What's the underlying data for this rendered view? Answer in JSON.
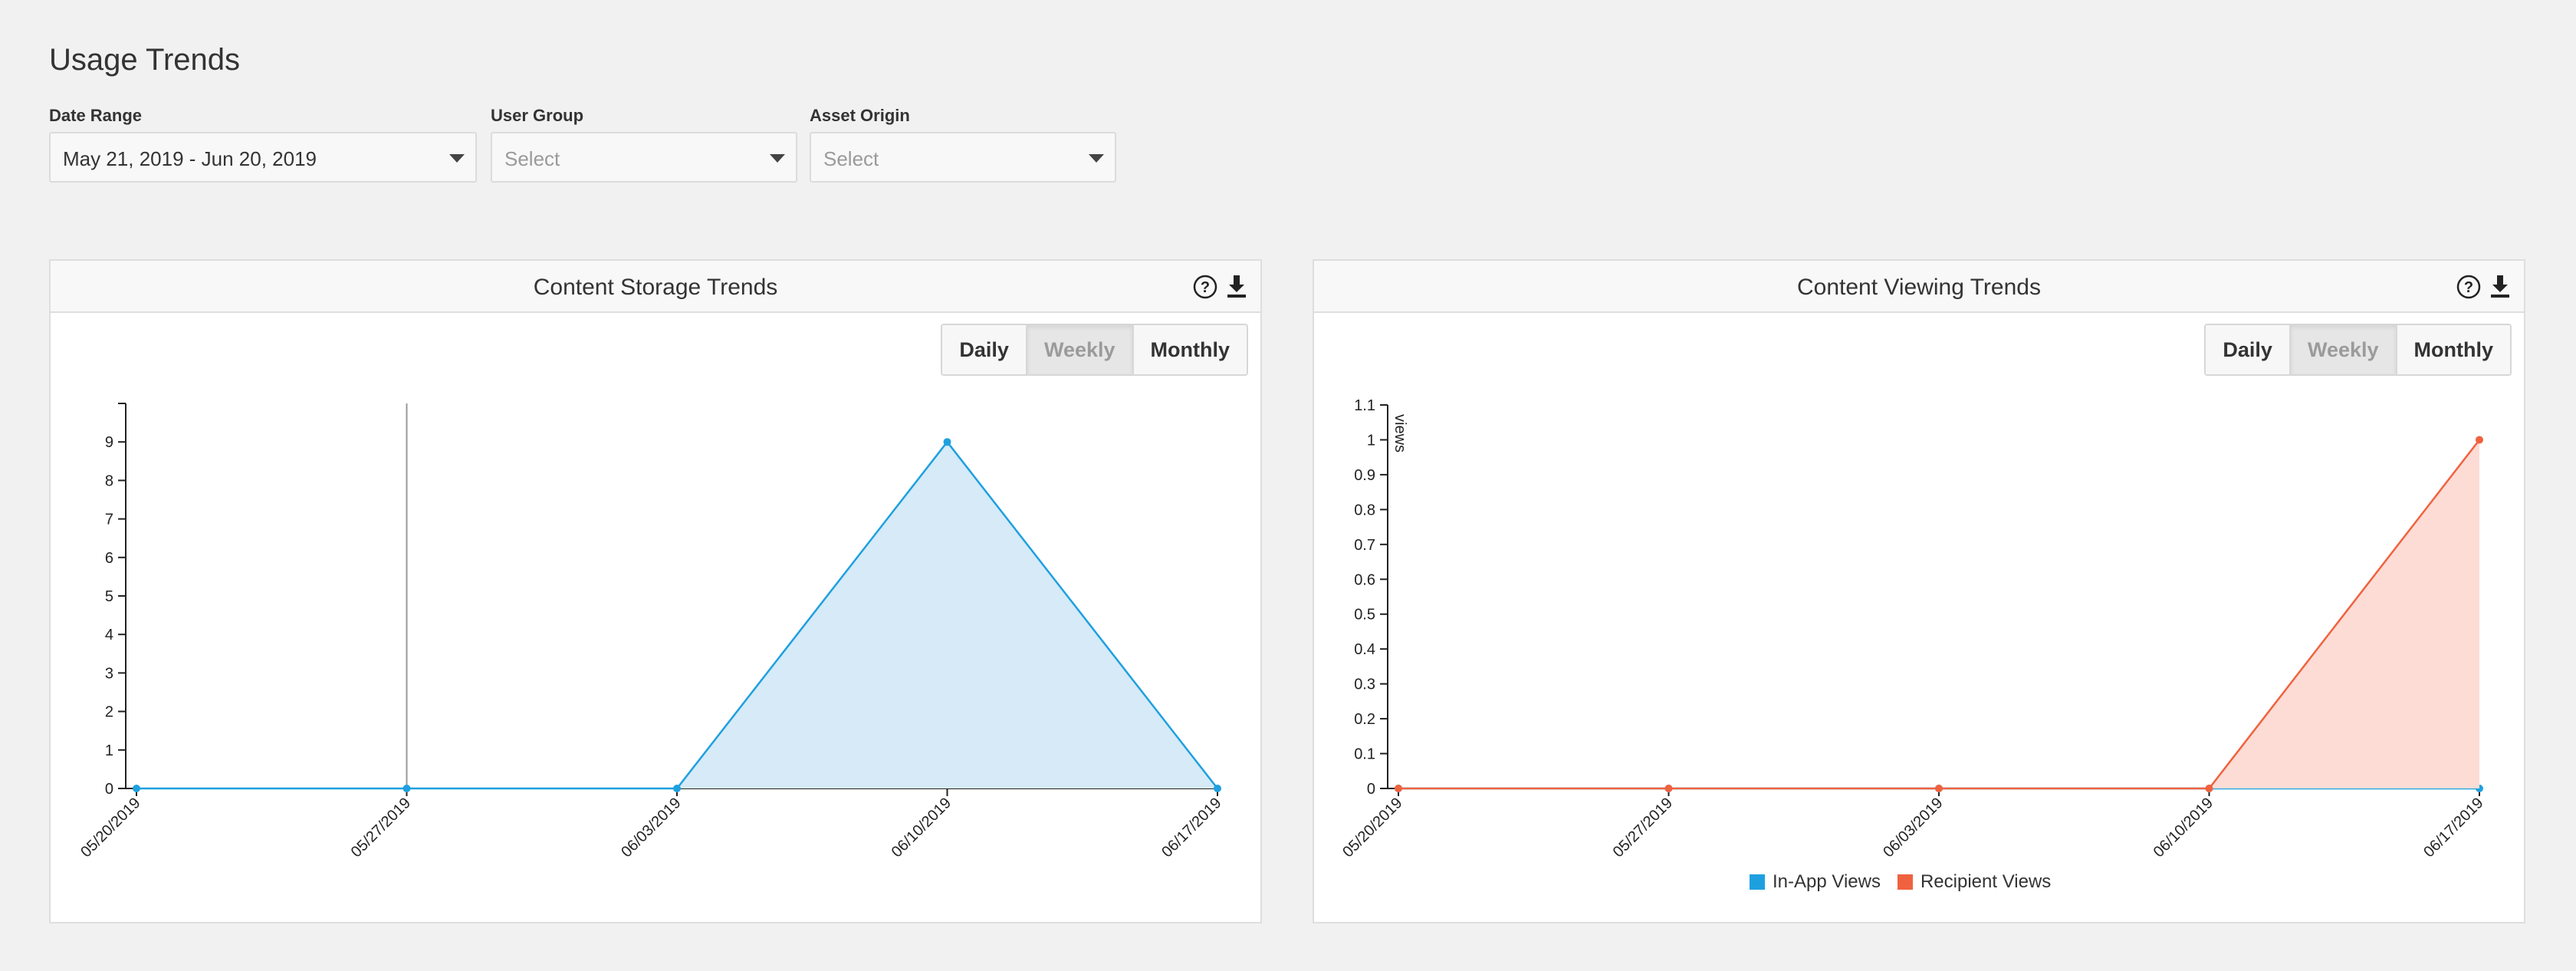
{
  "page": {
    "title": "Usage Trends"
  },
  "filters": [
    {
      "label": "Date Range",
      "value": "May 21, 2019 - Jun 20, 2019",
      "placeholder": false
    },
    {
      "label": "User Group",
      "value": "Select",
      "placeholder": true
    },
    {
      "label": "Asset Origin",
      "value": "Select",
      "placeholder": true
    }
  ],
  "cards": [
    {
      "title": "Content Storage Trends",
      "buttons": [
        "Daily",
        "Weekly",
        "Monthly"
      ],
      "active_button": "Weekly"
    },
    {
      "title": "Content Viewing Trends",
      "buttons": [
        "Daily",
        "Weekly",
        "Monthly"
      ],
      "active_button": "Weekly"
    }
  ],
  "colors": {
    "in_app": "#1ea0e0",
    "recipient": "#f0623f",
    "in_app_fill": "#d6eaf7",
    "recipient_fill": "#fcdcd5"
  },
  "chart_data": [
    {
      "type": "area",
      "title": "Content Storage Trends",
      "xlabel": "",
      "ylabel": "",
      "categories": [
        "05/20/2019",
        "05/27/2019",
        "06/03/2019",
        "06/10/2019",
        "06/17/2019"
      ],
      "yticks": [
        0,
        1,
        2,
        3,
        4,
        5,
        6,
        7,
        8,
        9
      ],
      "ylim": [
        0,
        10
      ],
      "marker_line_at": "05/27/2019",
      "series": [
        {
          "values": [
            0,
            0,
            0,
            9,
            0
          ]
        }
      ]
    },
    {
      "type": "area",
      "title": "Content Viewing Trends",
      "xlabel": "",
      "ylabel": "views",
      "categories": [
        "05/20/2019",
        "05/27/2019",
        "06/03/2019",
        "06/10/2019",
        "06/17/2019"
      ],
      "yticks": [
        0,
        0.1,
        0.2,
        0.3,
        0.4,
        0.5,
        0.6,
        0.7,
        0.8,
        0.9,
        1,
        1.1
      ],
      "ylim": [
        0,
        1.1
      ],
      "legend_position": "bottom",
      "series": [
        {
          "name": "In-App Views",
          "values": [
            0,
            0,
            0,
            0,
            0
          ]
        },
        {
          "name": "Recipient Views",
          "values": [
            0,
            0,
            0,
            0,
            1
          ]
        }
      ]
    }
  ]
}
